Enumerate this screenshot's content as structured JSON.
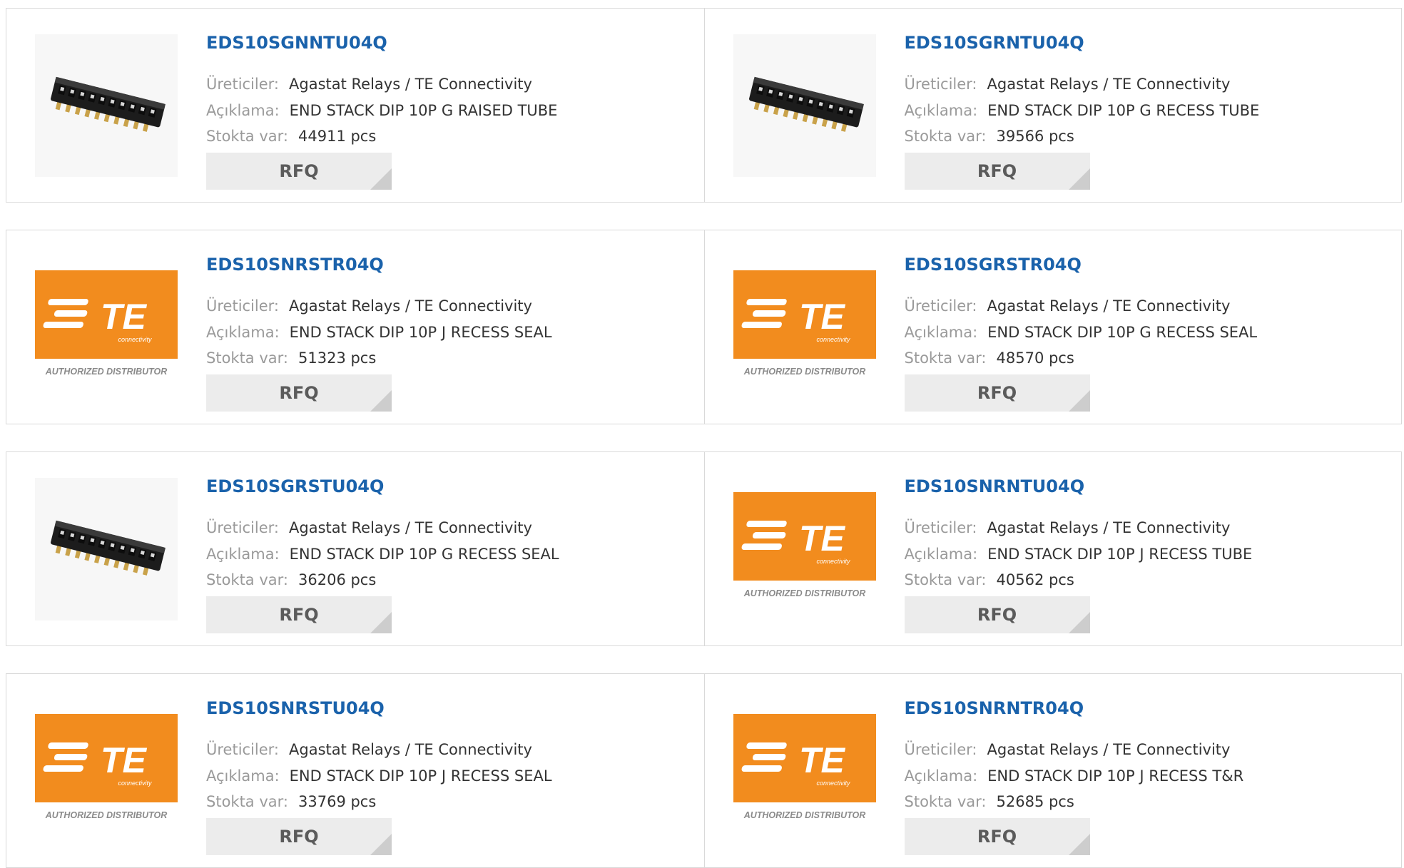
{
  "labels": {
    "maker": "Üreticiler:",
    "desc": "Açıklama:",
    "stock": "Stokta var:",
    "rfq": "RFQ"
  },
  "colors": {
    "link": "#1a62ab",
    "te_orange": "#f28c1e",
    "label_gray": "#9a9a9a",
    "button_bg": "#ececec"
  },
  "products": [
    {
      "part": "EDS10SGNNTU04Q",
      "maker": "Agastat Relays / TE Connectivity",
      "desc": "END STACK DIP 10P G RAISED TUBE",
      "stock": "44911 pcs",
      "image": "dip-switch-photo"
    },
    {
      "part": "EDS10SGRNTU04Q",
      "maker": "Agastat Relays / TE Connectivity",
      "desc": "END STACK DIP 10P G RECESS TUBE",
      "stock": "39566 pcs",
      "image": "dip-switch-photo"
    },
    {
      "part": "EDS10SNRSTR04Q",
      "maker": "Agastat Relays / TE Connectivity",
      "desc": "END STACK DIP 10P J RECESS SEAL",
      "stock": "51323 pcs",
      "image": "te-authorized-logo"
    },
    {
      "part": "EDS10SGRSTR04Q",
      "maker": "Agastat Relays / TE Connectivity",
      "desc": "END STACK DIP 10P G RECESS SEAL",
      "stock": "48570 pcs",
      "image": "te-authorized-logo"
    },
    {
      "part": "EDS10SGRSTU04Q",
      "maker": "Agastat Relays / TE Connectivity",
      "desc": "END STACK DIP 10P G RECESS SEAL",
      "stock": "36206 pcs",
      "image": "dip-switch-photo"
    },
    {
      "part": "EDS10SNRNTU04Q",
      "maker": "Agastat Relays / TE Connectivity",
      "desc": "END STACK DIP 10P J RECESS TUBE",
      "stock": "40562 pcs",
      "image": "te-authorized-logo"
    },
    {
      "part": "EDS10SNRSTU04Q",
      "maker": "Agastat Relays / TE Connectivity",
      "desc": "END STACK DIP 10P J RECESS SEAL",
      "stock": "33769 pcs",
      "image": "te-authorized-logo"
    },
    {
      "part": "EDS10SNRNTR04Q",
      "maker": "Agastat Relays / TE Connectivity",
      "desc": "END STACK DIP 10P J RECESS T&R",
      "stock": "52685 pcs",
      "image": "te-authorized-logo"
    }
  ],
  "logo": {
    "mark": "TE",
    "sub": "connectivity",
    "caption": "AUTHORIZED DISTRIBUTOR"
  }
}
